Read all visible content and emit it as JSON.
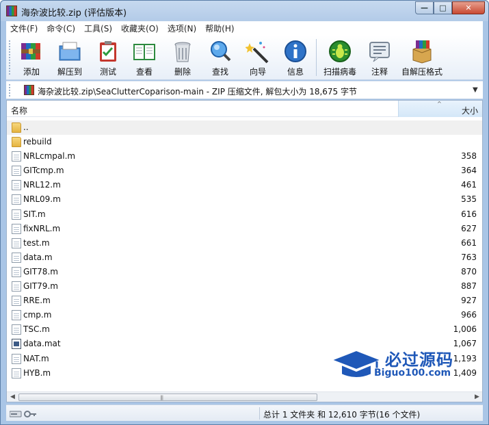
{
  "window": {
    "title": "海杂波比较.zip (评估版本)",
    "controls": {
      "minimize": "—",
      "maximize": "□",
      "close": "✕"
    }
  },
  "menu": [
    "文件(F)",
    "命令(C)",
    "工具(S)",
    "收藏夹(O)",
    "选项(N)",
    "帮助(H)"
  ],
  "toolbar": {
    "add": "添加",
    "extract": "解压到",
    "test": "测试",
    "view": "查看",
    "delete": "删除",
    "find": "查找",
    "wizard": "向导",
    "info": "信息",
    "virus_scan": "扫描病毒",
    "comment": "注释",
    "sfx": "自解压格式"
  },
  "address": {
    "path": "海杂波比较.zip\\SeaClutterCoparison-main - ZIP 压缩文件, 解包大小为 18,675 字节",
    "dropdown": "▼"
  },
  "list": {
    "columns": {
      "name": "名称",
      "size": "大小",
      "sort_indicator": "^"
    },
    "rows": [
      {
        "name": "..",
        "size": "",
        "type": "folder"
      },
      {
        "name": "rebuild",
        "size": "",
        "type": "folder"
      },
      {
        "name": "NRLcmpal.m",
        "size": "358",
        "type": "file"
      },
      {
        "name": "GITcmp.m",
        "size": "364",
        "type": "file"
      },
      {
        "name": "NRL12.m",
        "size": "461",
        "type": "file"
      },
      {
        "name": "NRL09.m",
        "size": "535",
        "type": "file"
      },
      {
        "name": "SIT.m",
        "size": "616",
        "type": "file"
      },
      {
        "name": "fixNRL.m",
        "size": "627",
        "type": "file"
      },
      {
        "name": "test.m",
        "size": "661",
        "type": "file"
      },
      {
        "name": "data.m",
        "size": "763",
        "type": "file"
      },
      {
        "name": "GIT78.m",
        "size": "870",
        "type": "file"
      },
      {
        "name": "GIT79.m",
        "size": "887",
        "type": "file"
      },
      {
        "name": "RRE.m",
        "size": "927",
        "type": "file"
      },
      {
        "name": "cmp.m",
        "size": "966",
        "type": "file"
      },
      {
        "name": "TSC.m",
        "size": "1,006",
        "type": "file"
      },
      {
        "name": "data.mat",
        "size": "1,067",
        "type": "mat"
      },
      {
        "name": "NAT.m",
        "size": "1,193",
        "type": "file"
      },
      {
        "name": "HYB.m",
        "size": "1,409",
        "type": "file"
      }
    ]
  },
  "scrollbar": {
    "left": "◀",
    "right": "▶",
    "grip": "|||"
  },
  "watermark": {
    "main": "必过源码",
    "sub": "Biguo100.com"
  },
  "status": {
    "summary": "总计 1 文件夹 和 12,610 字节(16 个文件)"
  },
  "colors": {
    "frame": "#a9c5e6",
    "accent_blue": "#1f58b8",
    "close_red": "#c94a33"
  }
}
